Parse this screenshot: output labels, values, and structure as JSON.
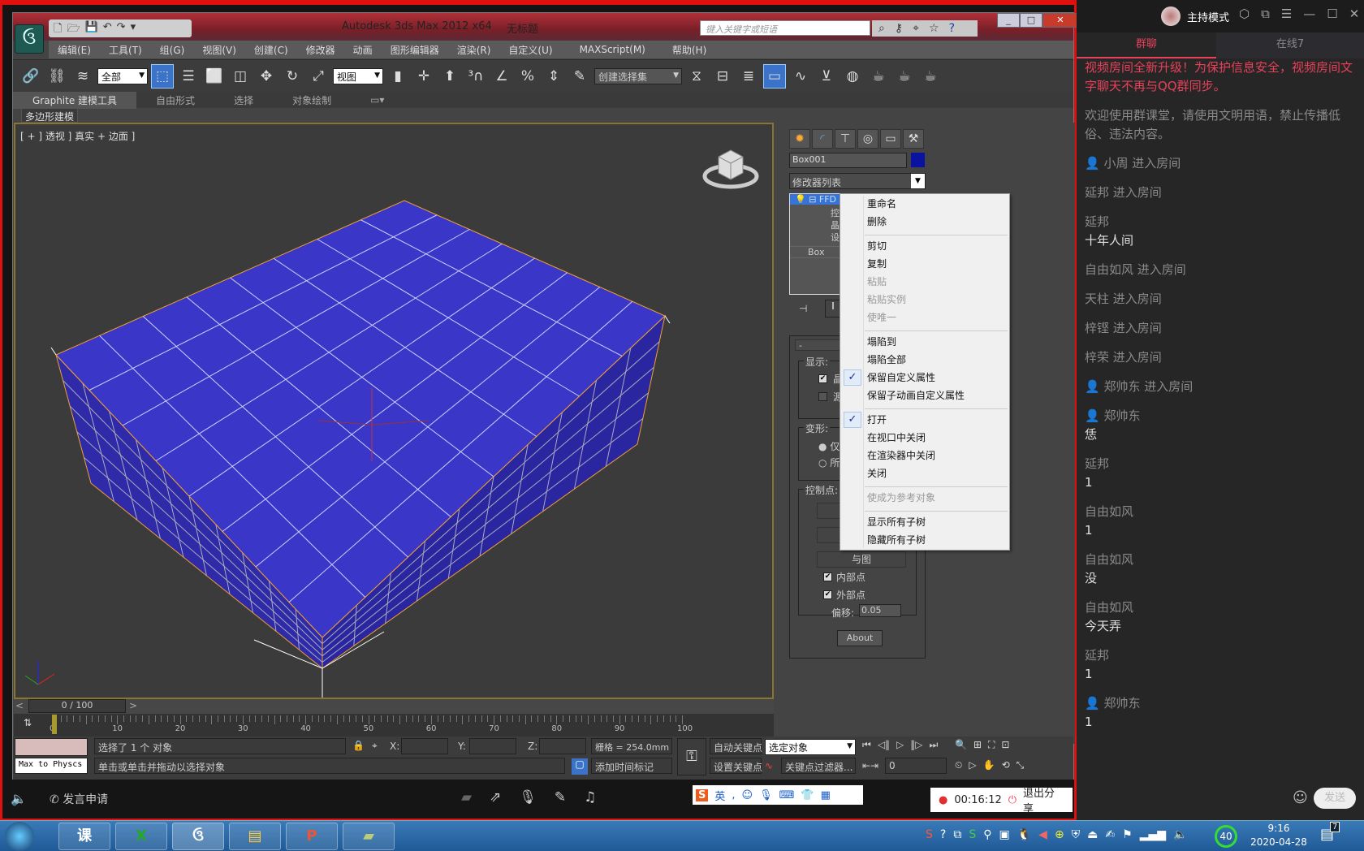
{
  "app": {
    "title": "Autodesk 3ds Max  2012 x64",
    "document": "无标题",
    "search_placeholder": "键入关键字或短语",
    "menu": [
      "编辑(E)",
      "工具(T)",
      "组(G)",
      "视图(V)",
      "创建(C)",
      "修改器",
      "动画",
      "图形编辑器",
      "渲染(R)",
      "自定义(U)",
      "MAXScript(M)",
      "帮助(H)"
    ],
    "toolbar": {
      "selection_filter": "全部",
      "ref_coord": "视图",
      "named_selection": "创建选择集"
    },
    "ribbon_tabs": [
      "Graphite 建模工具",
      "自由形式",
      "选择",
      "对象绘制"
    ],
    "ribbon_sub": "多边形建模",
    "viewport_label": "[ + ] 透视 ] 真实 + 边面 ]"
  },
  "command_panel": {
    "object_name": "Box001",
    "object_color": "#0a12a0",
    "modifier_list": "修改器列表",
    "stack": [
      "FFD 2",
      "控制",
      "晶格",
      "设置",
      "Box"
    ],
    "rollout_title": "FF",
    "groups": {
      "display": "显示:",
      "deform": "变形:",
      "control_points": "控制点:"
    },
    "display_opts": [
      "晶格",
      "源体"
    ],
    "deform_opts": [
      "仅在",
      "所有"
    ],
    "cp_buttons": [
      "重",
      "全部",
      "与图"
    ],
    "inner_points": "内部点",
    "outer_points": "外部点",
    "offset_label": "偏移:",
    "offset_value": "0.05",
    "about": "About"
  },
  "context_menu": [
    {
      "label": "重命名",
      "enabled": true
    },
    {
      "label": "删除",
      "enabled": true
    },
    {
      "label": "剪切",
      "enabled": true
    },
    {
      "label": "复制",
      "enabled": true
    },
    {
      "label": "粘贴",
      "enabled": false
    },
    {
      "label": "粘贴实例",
      "enabled": false
    },
    {
      "label": "使唯一",
      "enabled": false
    },
    {
      "label": "塌陷到",
      "enabled": true
    },
    {
      "label": "塌陷全部",
      "enabled": true
    },
    {
      "label": "保留自定义属性",
      "enabled": true,
      "checked": true
    },
    {
      "label": "保留子动画自定义属性",
      "enabled": true
    },
    {
      "label": "打开",
      "enabled": true,
      "checked": true
    },
    {
      "label": "在视口中关闭",
      "enabled": true
    },
    {
      "label": "在渲染器中关闭",
      "enabled": true
    },
    {
      "label": "关闭",
      "enabled": true
    },
    {
      "label": "使成为参考对象",
      "enabled": false
    },
    {
      "label": "显示所有子树",
      "enabled": true
    },
    {
      "label": "隐藏所有子树",
      "enabled": true
    }
  ],
  "timeline": {
    "frame": "0 / 100",
    "ticks": [
      "0",
      "10",
      "20",
      "30",
      "40",
      "50",
      "60",
      "70",
      "80",
      "90",
      "100"
    ]
  },
  "status": {
    "script_listener": "Max to Physcs (",
    "selected": "选择了 1 个 对象",
    "prompt": "单击或单击并拖动以选择对象",
    "x_label": "X:",
    "y_label": "Y:",
    "z_label": "Z:",
    "grid": "栅格 = 254.0mm",
    "add_time_tag": "添加时间标记",
    "auto_key": "自动关键点",
    "set_key": "设置关键点",
    "key_mode": "选定对象",
    "key_filters": "关键点过滤器...",
    "current_frame": "0"
  },
  "share_bar": {
    "request_speak": "发言申请",
    "ime": "英",
    "timer": "00:16:12",
    "exit_share": "退出分享"
  },
  "taskbar": {
    "time": "9:16",
    "date": "2020-04-28",
    "badge": "40",
    "notif_count": "7"
  },
  "chat": {
    "mode": "主持模式",
    "tabs": [
      "群聊",
      "在线7"
    ],
    "accent": "#e8415a",
    "notice": "视频房间全新升级！为保护信息安全，视频房间文字聊天不再与QQ群同步。",
    "welcome": "欢迎使用群课堂，请使用文明用语，禁止传播低俗、违法内容。",
    "messages": [
      {
        "name": "小周 进入房间",
        "icon": true
      },
      {
        "name": "延邦 进入房间"
      },
      {
        "name": "延邦",
        "text": "十年人间"
      },
      {
        "name": "自由如风 进入房间"
      },
      {
        "name": "天柱 进入房间"
      },
      {
        "name": "梓铿 进入房间"
      },
      {
        "name": "梓荣 进入房间"
      },
      {
        "name": "郑帅东 进入房间",
        "icon": true
      },
      {
        "name": "郑帅东",
        "text": "恁",
        "icon": true
      },
      {
        "name": "延邦",
        "text": "1"
      },
      {
        "name": "自由如风",
        "text": "1"
      },
      {
        "name": "自由如风",
        "text": "没"
      },
      {
        "name": "自由如风",
        "text": "今天弄"
      },
      {
        "name": "延邦",
        "text": "1"
      },
      {
        "name": "郑帅东",
        "text": "1",
        "icon": true
      }
    ],
    "send": "发送"
  }
}
